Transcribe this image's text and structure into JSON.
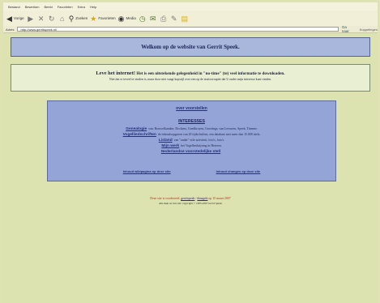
{
  "menu": [
    "Bestand",
    "Bewerken",
    "Beeld",
    "Favorieten",
    "Extra",
    "Help"
  ],
  "toolbar": {
    "back_label": "Vorige",
    "search_label": "Zoeken",
    "favorites_label": "Favorieten",
    "media_label": "Media"
  },
  "address": {
    "label": "Adres",
    "url": "http://www.gerritspeek.nl/",
    "go_label": "Ga naar",
    "links_label": "Koppelingen"
  },
  "page": {
    "title": "Welkom op de website van Gerrit Speek.",
    "intro_strong": "Leve het internet!",
    "intro_rest": " Het is een uitstekende gelegenheid in \"no-time\" (te) veel informatie te downloaden.",
    "intro_line2": "Niet dat er teveel te vinden is, maar door niet vaagt kopstijl over een op de stuitcorruptie dat U onder mijn interesse kunt vinden.",
    "nav_top": "over voorstellen",
    "heading": "INTERESSES",
    "rows": [
      {
        "link": "Genealogie",
        "text": "van: Bouwelkamker, Dockens, Goedkroyen, Groetings, van Leeuwen, Speek, Timmer."
      },
      {
        "link": "Vogelliedschriften",
        "text": "de inhoudsopgaven van 20 tijdschriften, een database met meer dan 15.000 titels."
      },
      {
        "link": "Lisland",
        "text": "van \"onder\" vele activiteit, foto's, foto's."
      },
      {
        "link": "Mijn werk",
        "text": "het Vogelbeskrijving in Heteren."
      },
      {
        "link": "",
        "text": "Nederlandse voorstedelijke stell"
      }
    ],
    "bottom_left": "Inhoud wikipagina op deze site",
    "bottom_right": "Inhoud changes op deze site",
    "footer_pre": "Deze site is voorbereid: ",
    "footer_link1": "gerritspeek",
    "footer_sep": " / ",
    "footer_link2": "dinagrik",
    "footer_post": " op 15 maart 2007",
    "footer_copy": "Alle data on this site: copyright © 1995-2007 Gerrit Speek"
  }
}
